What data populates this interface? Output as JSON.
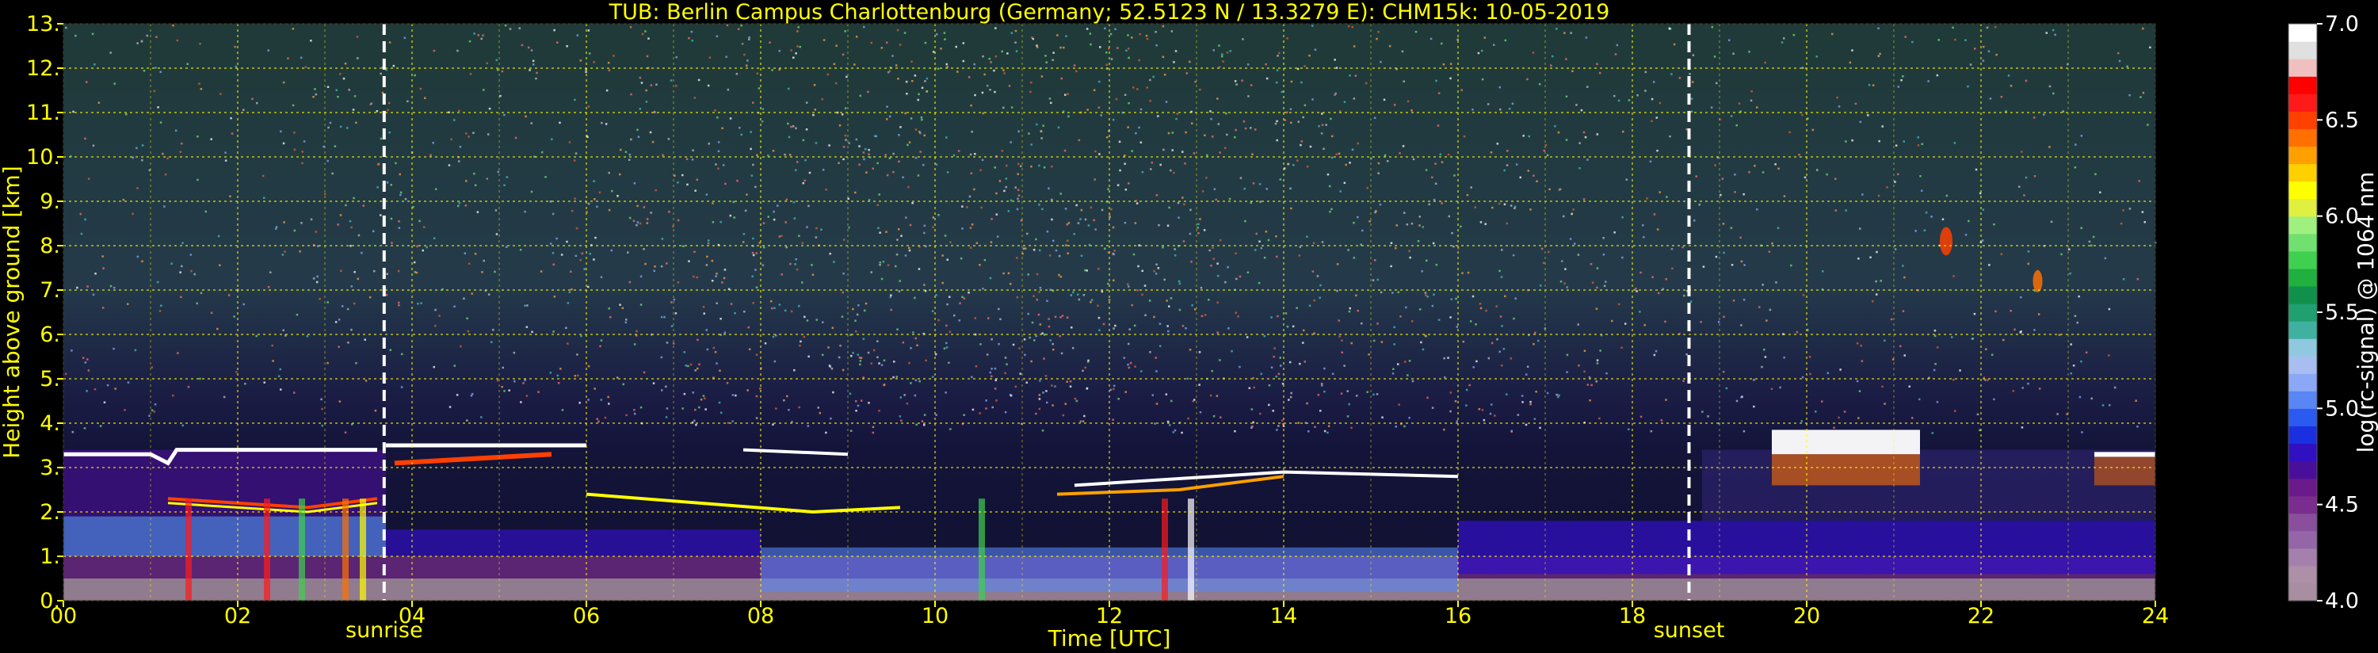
{
  "chart_data": {
    "type": "heatmap",
    "title": "TUB: Berlin Campus Charlottenburg (Germany; 52.5123 N / 13.3279 E):    CHM15k: 10-05-2019",
    "xlabel": "Time [UTC]",
    "ylabel": "Height above ground [km]",
    "xlim": [
      0,
      24
    ],
    "ylim": [
      0,
      13
    ],
    "x_ticks": [
      {
        "value": 0,
        "label": "00"
      },
      {
        "value": 2,
        "label": "02"
      },
      {
        "value": 4,
        "label": "04"
      },
      {
        "value": 6,
        "label": "06"
      },
      {
        "value": 8,
        "label": "08"
      },
      {
        "value": 10,
        "label": "10"
      },
      {
        "value": 12,
        "label": "12"
      },
      {
        "value": 14,
        "label": "14"
      },
      {
        "value": 16,
        "label": "16"
      },
      {
        "value": 18,
        "label": "18"
      },
      {
        "value": 20,
        "label": "20"
      },
      {
        "value": 22,
        "label": "22"
      },
      {
        "value": 24,
        "label": "24"
      }
    ],
    "y_ticks": [
      {
        "value": 0,
        "label": "0."
      },
      {
        "value": 1,
        "label": "1."
      },
      {
        "value": 2,
        "label": "2."
      },
      {
        "value": 3,
        "label": "3."
      },
      {
        "value": 4,
        "label": "4."
      },
      {
        "value": 5,
        "label": "5."
      },
      {
        "value": 6,
        "label": "6."
      },
      {
        "value": 7,
        "label": "7."
      },
      {
        "value": 8,
        "label": "8."
      },
      {
        "value": 9,
        "label": "9."
      },
      {
        "value": 10,
        "label": "10."
      },
      {
        "value": 11,
        "label": "11."
      },
      {
        "value": 12,
        "label": "12."
      },
      {
        "value": 13,
        "label": "13."
      }
    ],
    "grid": true,
    "annotations": [
      {
        "label": "sunrise",
        "x": 3.68
      },
      {
        "label": "sunset",
        "x": 18.65
      }
    ],
    "colorbar": {
      "label": "log(rc-signal) @ 1064 nm",
      "range": [
        4.0,
        7.0
      ],
      "ticks": [
        {
          "value": 4.0,
          "label": "4.0"
        },
        {
          "value": 4.5,
          "label": "4.5"
        },
        {
          "value": 5.0,
          "label": "5.0"
        },
        {
          "value": 5.5,
          "label": "5.5"
        },
        {
          "value": 6.0,
          "label": "6.0"
        },
        {
          "value": 6.5,
          "label": "6.5"
        },
        {
          "value": 7.0,
          "label": "7.0"
        }
      ],
      "colors": [
        "#a88ea0",
        "#ad8fa8",
        "#a680ad",
        "#9466a8",
        "#8a4f9c",
        "#7a2d8f",
        "#6a1a8a",
        "#4a0f9a",
        "#3010c0",
        "#1a30e0",
        "#2a5af0",
        "#5a85f5",
        "#8aa8f5",
        "#a8bef0",
        "#90c8e0",
        "#40b0a0",
        "#20a070",
        "#10904a",
        "#20b040",
        "#40d050",
        "#70e070",
        "#a0f080",
        "#e0f040",
        "#ffff00",
        "#ffd000",
        "#ffa000",
        "#ff7000",
        "#ff4000",
        "#ff1a1a",
        "#ff0000",
        "#f0c0c0",
        "#e0e0e0",
        "#ffffff"
      ]
    }
  }
}
